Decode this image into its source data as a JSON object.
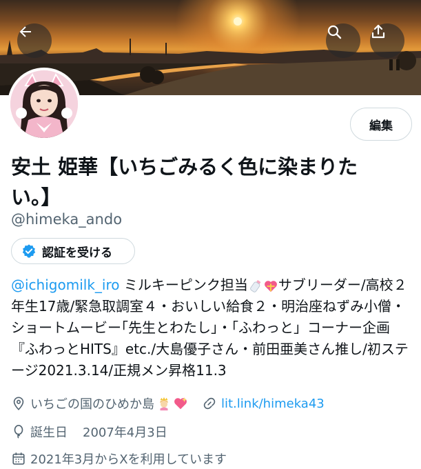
{
  "profile": {
    "display_name": "安土 姫華【いちごみるく色に染まりたい。】",
    "handle": "@himeka_ando",
    "edit_label": "編集",
    "verify_label": "認証を受ける",
    "bio_mention": "@ichigomilk_iro",
    "bio_part1": " ミルキーピンク担当",
    "bio_part2": "サブリーダー/高校２年生17歳/緊急取調室４・おいしい給食２・明治座ねずみ小僧・ショートムービー｢先生とわたし｣・「ふわっと」コーナー企画『ふわっとHITS』etc./大島優子さん・前田亜美さん推し/初ステージ2021.3.14/正規メン昇格11.3",
    "location": "いちごの国のひめか島",
    "website": "lit.link/himeka43",
    "birthday_label": "誕生日",
    "birthday": "2007年4月3日",
    "joined": "2021年3月からXを利用しています"
  },
  "icons": {
    "back": "arrow-left-icon",
    "search": "search-icon",
    "share": "share-icon",
    "verified": "verified-badge-icon",
    "location": "location-pin-icon",
    "link": "link-icon",
    "birthday": "balloon-icon",
    "calendar": "calendar-icon",
    "emoji_bottle": "baby-bottle-emoji",
    "emoji_heart": "heart-with-ribbon-emoji",
    "emoji_princess": "princess-emoji",
    "emoji_sparkle_heart": "sparkling-heart-emoji"
  },
  "colors": {
    "accent": "#1d9bf0",
    "secondary_text": "#536471",
    "border": "#cfd9de"
  }
}
